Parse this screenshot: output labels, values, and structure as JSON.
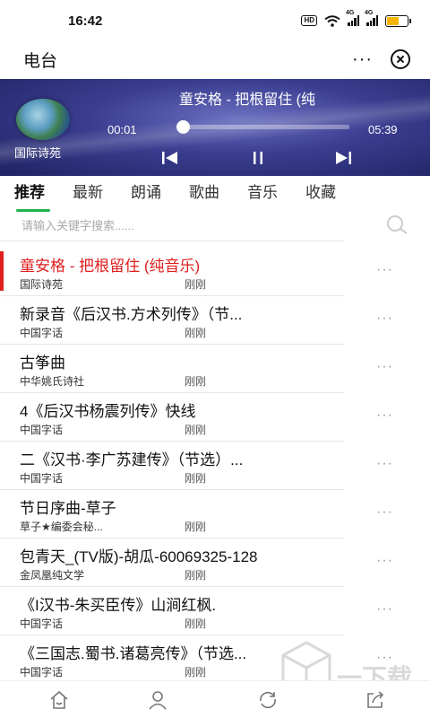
{
  "status_bar": {
    "time": "16:42",
    "hd": "HD",
    "net1": "4G",
    "net2": "4G",
    "battery_level": 0.6
  },
  "titlebar": {
    "title": "电台",
    "more": "···"
  },
  "player": {
    "station": "国际诗苑",
    "now_playing": "童安格 - 把根留住 (纯",
    "current_time": "00:01",
    "total_time": "05:39",
    "progress": 0.003
  },
  "tabs": [
    "推荐",
    "最新",
    "朗诵",
    "歌曲",
    "音乐",
    "收藏"
  ],
  "active_tab": 0,
  "search": {
    "placeholder": "请输入关键字搜索......"
  },
  "list": [
    {
      "name": "童安格 - 把根留住 (纯音乐)",
      "source": "国际诗苑",
      "time": "刚刚",
      "active": true
    },
    {
      "name": "新录音《后汉书.方术列传》（节...",
      "source": "中国字话",
      "time": "刚刚"
    },
    {
      "name": "古筝曲",
      "source": "中华姚氏诗社",
      "time": "刚刚"
    },
    {
      "name": "4《后汉书杨震列传》快线",
      "source": "中国字话",
      "time": "刚刚"
    },
    {
      "name": "二《汉书·李广苏建传》（节选）...",
      "source": "中国字话",
      "time": "刚刚"
    },
    {
      "name": "节日序曲-草子",
      "source": "草子★编委会秘...",
      "time": "刚刚"
    },
    {
      "name": "包青天_(TV版)-胡瓜-60069325-128",
      "source": "金凤凰纯文学",
      "time": "刚刚"
    },
    {
      "name": "《I汉书-朱买臣传》山涧红枫.",
      "source": "中国字话",
      "time": "刚刚"
    },
    {
      "name": "《三国志.蜀书.诸葛亮传》（节选...",
      "source": "中国字话",
      "time": "刚刚"
    }
  ],
  "more_dots": "···",
  "bottom_nav": [
    "home-icon",
    "user-icon",
    "refresh-icon",
    "share-icon"
  ],
  "watermark": {
    "text": "一下载"
  },
  "colors": {
    "accent": "#22b14c",
    "active_text": "#e02020",
    "player_bg": "#3a3d8f"
  }
}
